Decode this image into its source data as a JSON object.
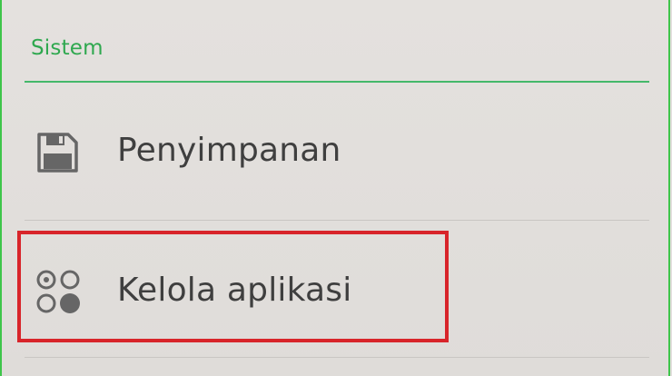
{
  "section": {
    "title": "Sistem"
  },
  "items": [
    {
      "label": "Penyimpanan",
      "icon": "floppy-disk-icon"
    },
    {
      "label": "Kelola aplikasi",
      "icon": "apps-grid-icon"
    }
  ],
  "colors": {
    "accent": "#2fa84f",
    "highlight": "#d8242a",
    "frame": "#3ec54a",
    "text": "#3f3f3f"
  }
}
